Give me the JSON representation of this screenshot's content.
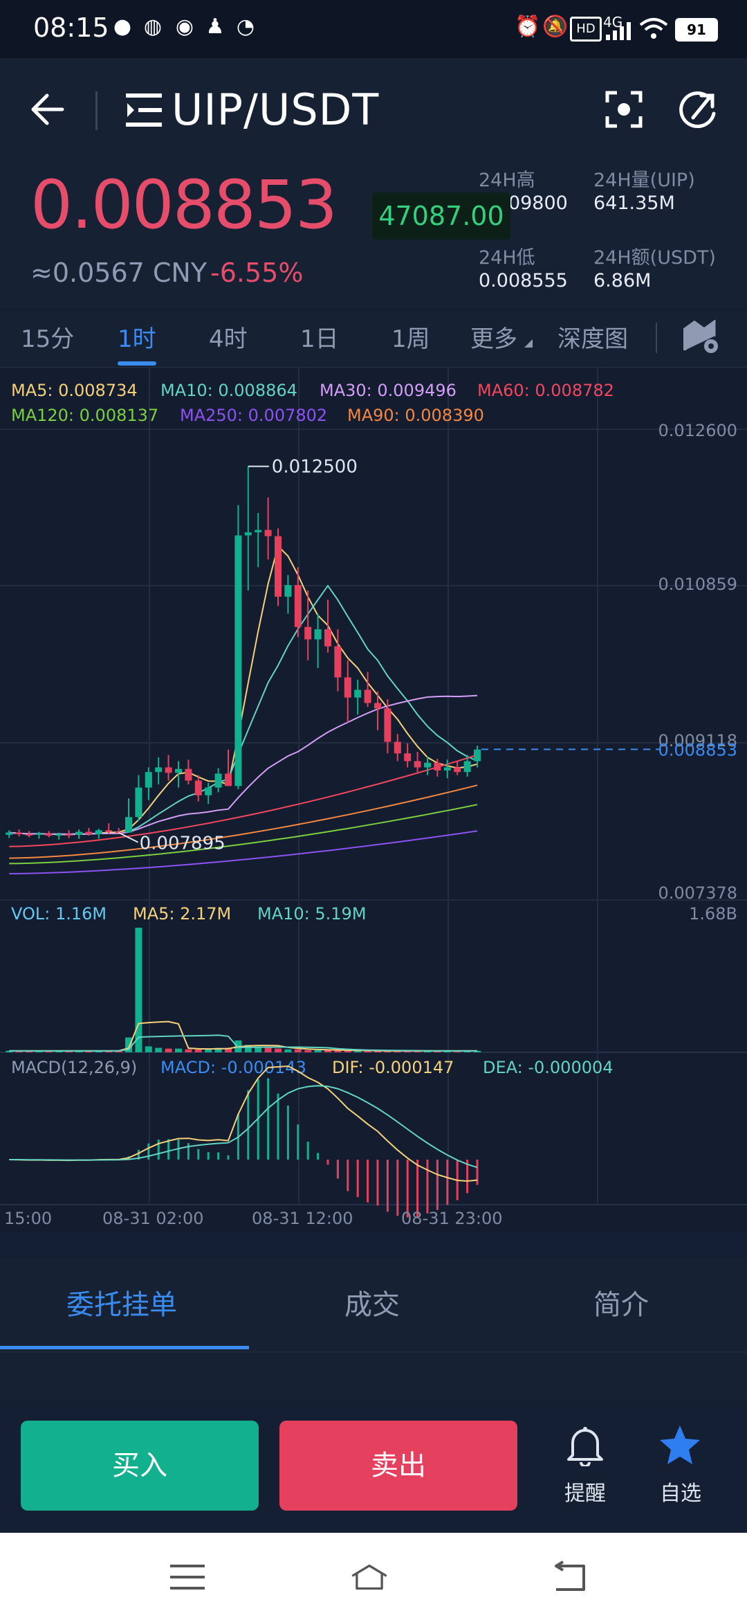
{
  "status_bar": {
    "time": "08:15",
    "battery": "91",
    "signal_text": "4G",
    "hd_text": "HD"
  },
  "header": {
    "pair": "UIP/USDT",
    "price": "0.008853",
    "cny_price": "≈0.0567 CNY",
    "change": "-6.55%",
    "float_tag": "47087.00",
    "stats": {
      "high_label": "24H高",
      "high_value": "0.009800",
      "vol_label": "24H量(UIP)",
      "vol_value": "641.35M",
      "low_label": "24H低",
      "low_value": "0.008555",
      "amount_label": "24H额(USDT)",
      "amount_value": "6.86M"
    }
  },
  "timeframe_tabs": {
    "items": [
      "15分",
      "1时",
      "4时",
      "1日",
      "1周",
      "更多",
      "深度图"
    ],
    "active": "1时"
  },
  "chart_data": {
    "type": "candlestick",
    "price_ticks": [
      "0.012600",
      "0.010859",
      "0.009118",
      "0.007378"
    ],
    "current_price_label": "0.008853",
    "high_marker": "0.012500",
    "low_marker": "0.007895",
    "ma_legend": [
      {
        "label": "MA5: 0.008734",
        "color": "#f5d27a"
      },
      {
        "label": "MA10: 0.008864",
        "color": "#63d4c3"
      },
      {
        "label": "MA30: 0.009496",
        "color": "#d49ef6"
      },
      {
        "label": "MA60: 0.008782",
        "color": "#f2475d"
      },
      {
        "label": "MA120: 0.008137",
        "color": "#7ccf3f"
      },
      {
        "label": "MA250: 0.007802",
        "color": "#8d52f2"
      },
      {
        "label": "MA90: 0.008390",
        "color": "#f58840"
      }
    ],
    "volume_legend": [
      {
        "label": "VOL: 1.16M",
        "color": "#63c8f2"
      },
      {
        "label": "MA5: 2.17M",
        "color": "#f5d27a"
      },
      {
        "label": "MA10: 5.19M",
        "color": "#63d4c3"
      }
    ],
    "volume_max": "1.68B",
    "macd_legend": [
      {
        "label": "MACD(12,26,9)",
        "color": "#8e9bb3"
      },
      {
        "label": "MACD: -0.000143",
        "color": "#3b8cf0"
      },
      {
        "label": "DIF: -0.000147",
        "color": "#f5d27a"
      },
      {
        "label": "DEA: -0.000004",
        "color": "#63d4c3"
      }
    ],
    "x_ticks": [
      "15:00",
      "08-31 02:00",
      "08-31 12:00",
      "08-31 23:00"
    ],
    "candles": [
      {
        "o": 0.00775,
        "h": 0.00781,
        "l": 0.00771,
        "c": 0.00778
      },
      {
        "o": 0.00778,
        "h": 0.00782,
        "l": 0.00773,
        "c": 0.00776
      },
      {
        "o": 0.00776,
        "h": 0.0078,
        "l": 0.00772,
        "c": 0.00775
      },
      {
        "o": 0.00775,
        "h": 0.00779,
        "l": 0.0077,
        "c": 0.00777
      },
      {
        "o": 0.00777,
        "h": 0.0078,
        "l": 0.00772,
        "c": 0.00774
      },
      {
        "o": 0.00774,
        "h": 0.00778,
        "l": 0.00769,
        "c": 0.00776
      },
      {
        "o": 0.00776,
        "h": 0.00781,
        "l": 0.00771,
        "c": 0.00775
      },
      {
        "o": 0.00775,
        "h": 0.00782,
        "l": 0.0077,
        "c": 0.00779
      },
      {
        "o": 0.00779,
        "h": 0.00784,
        "l": 0.00774,
        "c": 0.00776
      },
      {
        "o": 0.00776,
        "h": 0.00783,
        "l": 0.0077,
        "c": 0.00781
      },
      {
        "o": 0.00781,
        "h": 0.0079,
        "l": 0.00776,
        "c": 0.00779
      },
      {
        "o": 0.00779,
        "h": 0.00784,
        "l": 0.0079,
        "c": 0.00778
      },
      {
        "o": 0.00778,
        "h": 0.00822,
        "l": 0.0079,
        "c": 0.00798
      },
      {
        "o": 0.00798,
        "h": 0.00852,
        "l": 0.00793,
        "c": 0.00836
      },
      {
        "o": 0.00836,
        "h": 0.00862,
        "l": 0.0082,
        "c": 0.00856
      },
      {
        "o": 0.00856,
        "h": 0.00875,
        "l": 0.0084,
        "c": 0.00862
      },
      {
        "o": 0.00862,
        "h": 0.00878,
        "l": 0.00845,
        "c": 0.00855
      },
      {
        "o": 0.00855,
        "h": 0.0087,
        "l": 0.00836,
        "c": 0.0086
      },
      {
        "o": 0.0086,
        "h": 0.00872,
        "l": 0.0084,
        "c": 0.00845
      },
      {
        "o": 0.00845,
        "h": 0.00852,
        "l": 0.00818,
        "c": 0.00826
      },
      {
        "o": 0.00826,
        "h": 0.00842,
        "l": 0.00815,
        "c": 0.00836
      },
      {
        "o": 0.00836,
        "h": 0.00861,
        "l": 0.0083,
        "c": 0.00854
      },
      {
        "o": 0.00854,
        "h": 0.00885,
        "l": 0.00845,
        "c": 0.00838
      },
      {
        "o": 0.00838,
        "h": 0.012,
        "l": 0.00834,
        "c": 0.01161
      },
      {
        "o": 0.01161,
        "h": 0.0125,
        "l": 0.0109,
        "c": 0.01165
      },
      {
        "o": 0.01165,
        "h": 0.0119,
        "l": 0.0112,
        "c": 0.01168
      },
      {
        "o": 0.01168,
        "h": 0.0121,
        "l": 0.0113,
        "c": 0.0116
      },
      {
        "o": 0.0116,
        "h": 0.0117,
        "l": 0.0107,
        "c": 0.01082
      },
      {
        "o": 0.01082,
        "h": 0.0111,
        "l": 0.0106,
        "c": 0.01097
      },
      {
        "o": 0.01097,
        "h": 0.0112,
        "l": 0.0103,
        "c": 0.01043
      },
      {
        "o": 0.01043,
        "h": 0.0109,
        "l": 0.01,
        "c": 0.01027
      },
      {
        "o": 0.01027,
        "h": 0.0106,
        "l": 0.0099,
        "c": 0.0104
      },
      {
        "o": 0.0104,
        "h": 0.01078,
        "l": 0.0101,
        "c": 0.01018
      },
      {
        "o": 0.01018,
        "h": 0.0104,
        "l": 0.0096,
        "c": 0.00978
      },
      {
        "o": 0.00978,
        "h": 0.01,
        "l": 0.0092,
        "c": 0.00952
      },
      {
        "o": 0.00952,
        "h": 0.00975,
        "l": 0.0093,
        "c": 0.00962
      },
      {
        "o": 0.00962,
        "h": 0.00985,
        "l": 0.0094,
        "c": 0.00945
      },
      {
        "o": 0.00945,
        "h": 0.0096,
        "l": 0.0091,
        "c": 0.00938
      },
      {
        "o": 0.00938,
        "h": 0.0095,
        "l": 0.0088,
        "c": 0.00895
      },
      {
        "o": 0.00895,
        "h": 0.00905,
        "l": 0.0087,
        "c": 0.0088
      },
      {
        "o": 0.0088,
        "h": 0.00893,
        "l": 0.00862,
        "c": 0.0087
      },
      {
        "o": 0.0087,
        "h": 0.00882,
        "l": 0.00856,
        "c": 0.00862
      },
      {
        "o": 0.00862,
        "h": 0.00876,
        "l": 0.00852,
        "c": 0.00868
      },
      {
        "o": 0.00868,
        "h": 0.00873,
        "l": 0.0085,
        "c": 0.00858
      },
      {
        "o": 0.00858,
        "h": 0.00872,
        "l": 0.00848,
        "c": 0.00862
      },
      {
        "o": 0.00862,
        "h": 0.0087,
        "l": 0.00852,
        "c": 0.00856
      },
      {
        "o": 0.00856,
        "h": 0.00878,
        "l": 0.0085,
        "c": 0.0087
      },
      {
        "o": 0.0087,
        "h": 0.0089,
        "l": 0.00862,
        "c": 0.00885
      }
    ],
    "price_range": [
      0.007,
      0.0128
    ],
    "volumes": [
      0.02,
      0.02,
      0.02,
      0.02,
      0.02,
      0.02,
      0.02,
      0.02,
      0.02,
      0.02,
      0.02,
      0.02,
      0.2,
      1.68,
      0.08,
      0.06,
      0.05,
      0.05,
      0.04,
      0.04,
      0.05,
      0.06,
      0.06,
      0.16,
      0.1,
      0.08,
      0.06,
      0.05,
      0.04,
      0.04,
      0.03,
      0.03,
      0.03,
      0.03,
      0.02,
      0.02,
      0.02,
      0.02,
      0.02,
      0.02,
      0.02,
      0.02,
      0.02,
      0.02,
      0.02,
      0.02,
      0.02,
      0.02
    ]
  },
  "bottom_tabs": {
    "items": [
      "委托挂单",
      "成交",
      "简介"
    ],
    "active": "委托挂单"
  },
  "actions": {
    "buy": "买入",
    "sell": "卖出",
    "alert": "提醒",
    "favorite": "自选"
  },
  "colors": {
    "up": "#12b08f",
    "down": "#e5405e",
    "accent": "#3b8cf0",
    "background": "#151f33"
  }
}
